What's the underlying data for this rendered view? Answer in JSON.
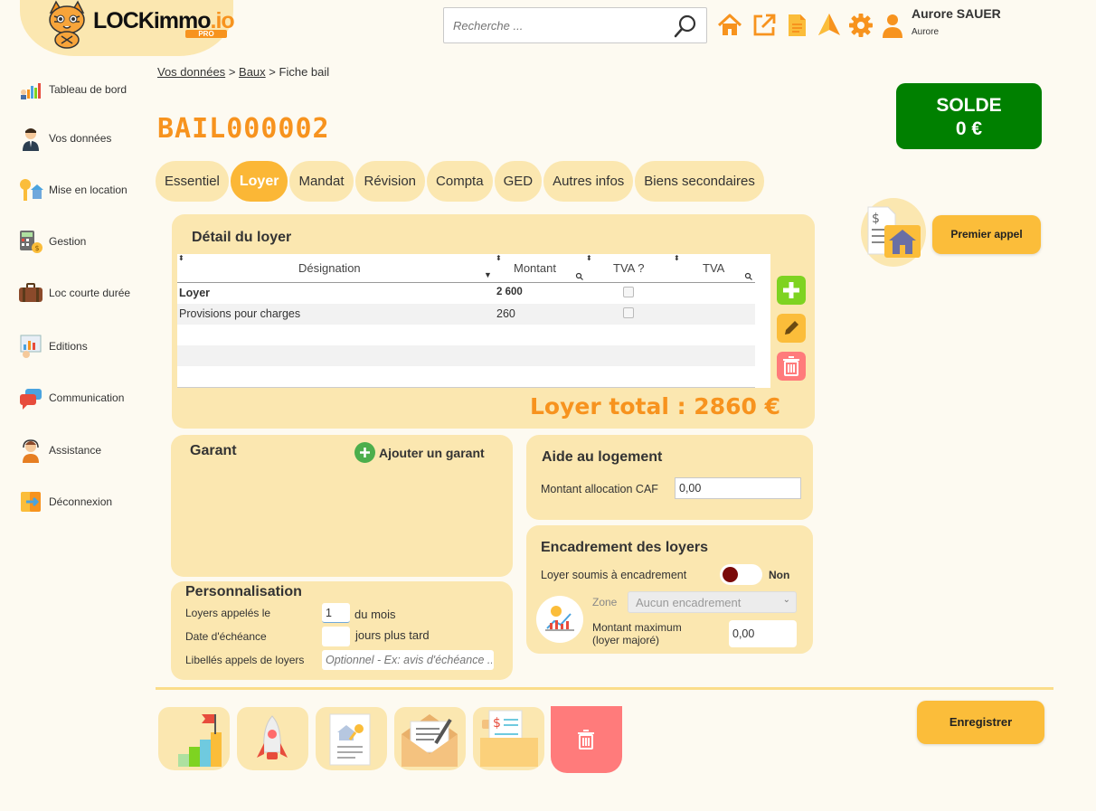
{
  "app": {
    "logo_main": "LOCKimmo",
    "logo_io": ".io",
    "logo_pro": "PRO"
  },
  "search": {
    "placeholder": "Recherche ..."
  },
  "user": {
    "name": "Aurore SAUER",
    "subtitle": "Aurore"
  },
  "top_icons": [
    "home-icon",
    "external-link-icon",
    "document-icon",
    "paper-plane-icon",
    "gear-icon",
    "user-icon"
  ],
  "sidebar": {
    "items": [
      {
        "label": "Tableau de bord",
        "icon": "dashboard-icon"
      },
      {
        "label": "Vos données",
        "icon": "person-icon"
      },
      {
        "label": "Mise en location",
        "icon": "key-house-icon"
      },
      {
        "label": "Gestion",
        "icon": "calculator-icon"
      },
      {
        "label": "Loc courte durée",
        "icon": "suitcase-icon"
      },
      {
        "label": "Editions",
        "icon": "report-icon"
      },
      {
        "label": "Communication",
        "icon": "chat-icon"
      },
      {
        "label": "Assistance",
        "icon": "support-icon"
      },
      {
        "label": "Déconnexion",
        "icon": "logout-icon"
      }
    ]
  },
  "breadcrumb": {
    "item1": "Vos données",
    "sep": ">",
    "item2": "Baux",
    "current": "Fiche bail"
  },
  "page": {
    "title": "BAIL000002"
  },
  "solde": {
    "label": "SOLDE",
    "value": "0 €",
    "color": "#008000"
  },
  "tabs": [
    {
      "label": "Essentiel"
    },
    {
      "label": "Loyer",
      "active": true
    },
    {
      "label": "Mandat"
    },
    {
      "label": "Révision"
    },
    {
      "label": "Compta"
    },
    {
      "label": "GED"
    },
    {
      "label": "Autres infos"
    },
    {
      "label": "Biens secondaires"
    }
  ],
  "detail_loyer": {
    "title": "Détail du loyer",
    "columns": [
      "Désignation",
      "Montant",
      "TVA ?",
      "TVA"
    ],
    "rows": [
      {
        "designation": "Loyer",
        "montant": "2 600",
        "tva_q": false,
        "bold": true
      },
      {
        "designation": "Provisions pour charges",
        "montant": "260",
        "tva_q": false,
        "bold": false
      }
    ],
    "total_label": "Loyer total : 2860 €"
  },
  "premier_appel": {
    "label": "Premier appel"
  },
  "garant": {
    "title": "Garant",
    "add_label": "Ajouter un garant"
  },
  "aide": {
    "title": "Aide au logement",
    "caf_label": "Montant allocation CAF",
    "caf_value": "0,00"
  },
  "personnalisation": {
    "title": "Personnalisation",
    "appel_label": "Loyers appelés le",
    "appel_value": "1",
    "appel_suffix": "du mois",
    "echeance_label": "Date d'échéance",
    "echeance_value": "",
    "echeance_suffix": "jours plus tard",
    "libelles_label": "Libellés appels de loyers",
    "libelles_placeholder": "Optionnel - Ex: avis d'échéance ..."
  },
  "encadrement": {
    "title": "Encadrement des loyers",
    "soumis_label": "Loyer soumis à encadrement",
    "soumis_value": "Non",
    "zone_label": "Zone",
    "zone_value": "Aucun encadrement",
    "max_label_1": "Montant maximum",
    "max_label_2": "(loyer majoré)",
    "max_value": "0,00"
  },
  "footer": {
    "save_label": "Enregistrer"
  },
  "colors": {
    "accent": "#f7931e",
    "panel": "#fbe7b0",
    "button": "#fbbd3a",
    "danger": "#ff7b7b",
    "add": "#7ed321"
  }
}
